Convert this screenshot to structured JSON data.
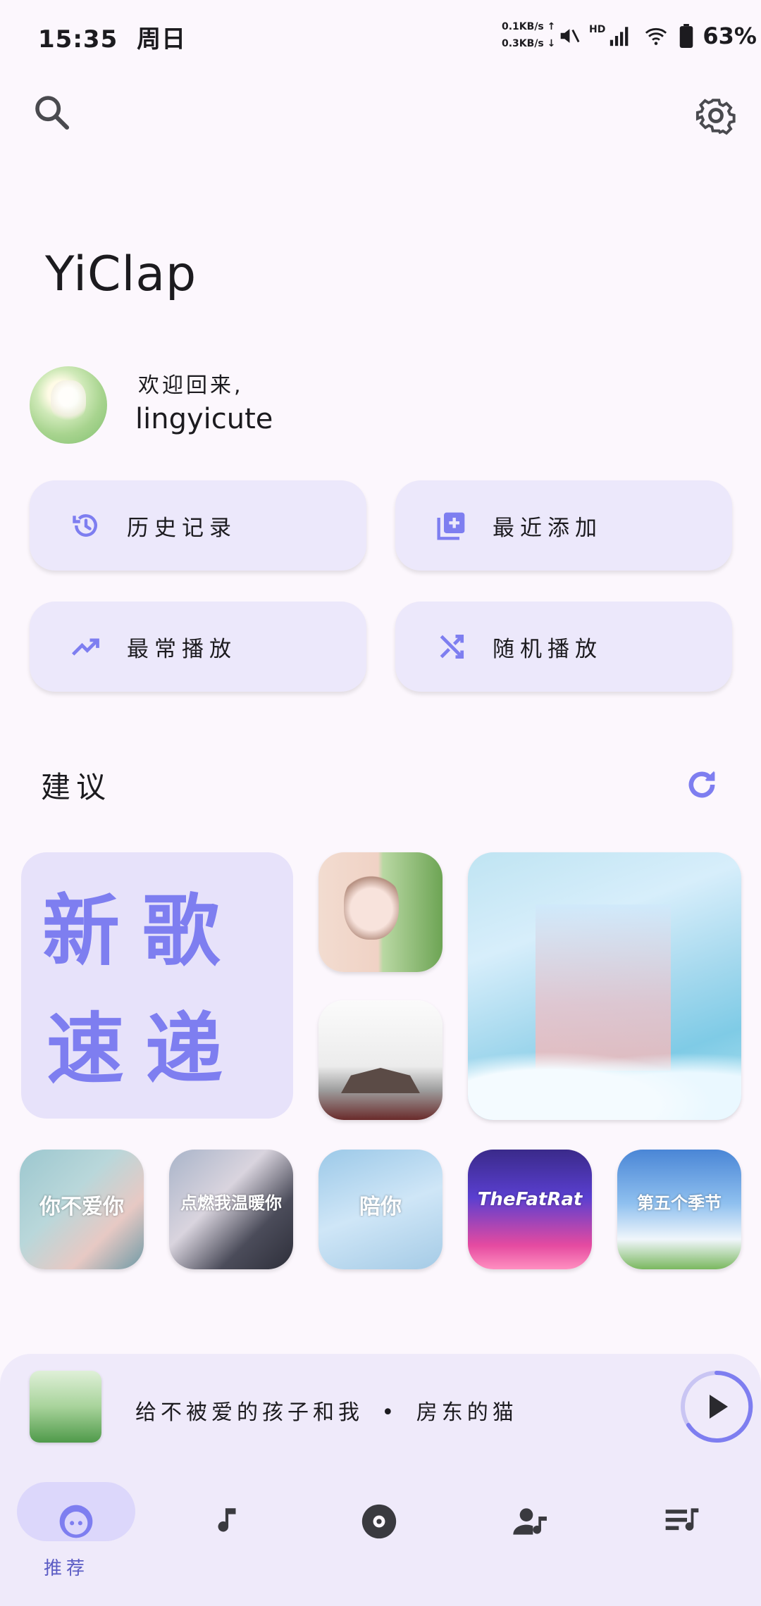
{
  "status_bar": {
    "time": "15:35",
    "day": "周日",
    "net_up": "0.1KB/s ↑",
    "net_down": "0.3KB/s ↓",
    "signal_label": "HD",
    "battery": "63%"
  },
  "header": {
    "app_title": "YiClap"
  },
  "welcome": {
    "greeting": "欢迎回来,",
    "username": "lingyicute"
  },
  "quick_actions": [
    {
      "label": "历史记录",
      "icon": "history-icon"
    },
    {
      "label": "最近添加",
      "icon": "library-add-icon"
    },
    {
      "label": "最常播放",
      "icon": "trending-up-icon"
    },
    {
      "label": "随机播放",
      "icon": "shuffle-icon"
    }
  ],
  "suggestions": {
    "title": "建议",
    "new_songs_chars": [
      "新",
      "歌",
      "速",
      "递"
    ],
    "row_covers": [
      "你不爱你",
      "点燃我温暖你",
      "陪你",
      "TheFatRat",
      "第五个季节"
    ]
  },
  "mini_player": {
    "track": "给不被爱的孩子和我",
    "separator": "•",
    "artist": "房东的猫"
  },
  "nav": {
    "active_label": "推荐",
    "items": [
      "recommend-icon",
      "music-note-icon",
      "album-icon",
      "artist-icon",
      "playlist-icon"
    ]
  },
  "colors": {
    "accent": "#7e7ef0",
    "card_bg": "#ece8fb",
    "background": "#fcf7fd"
  }
}
